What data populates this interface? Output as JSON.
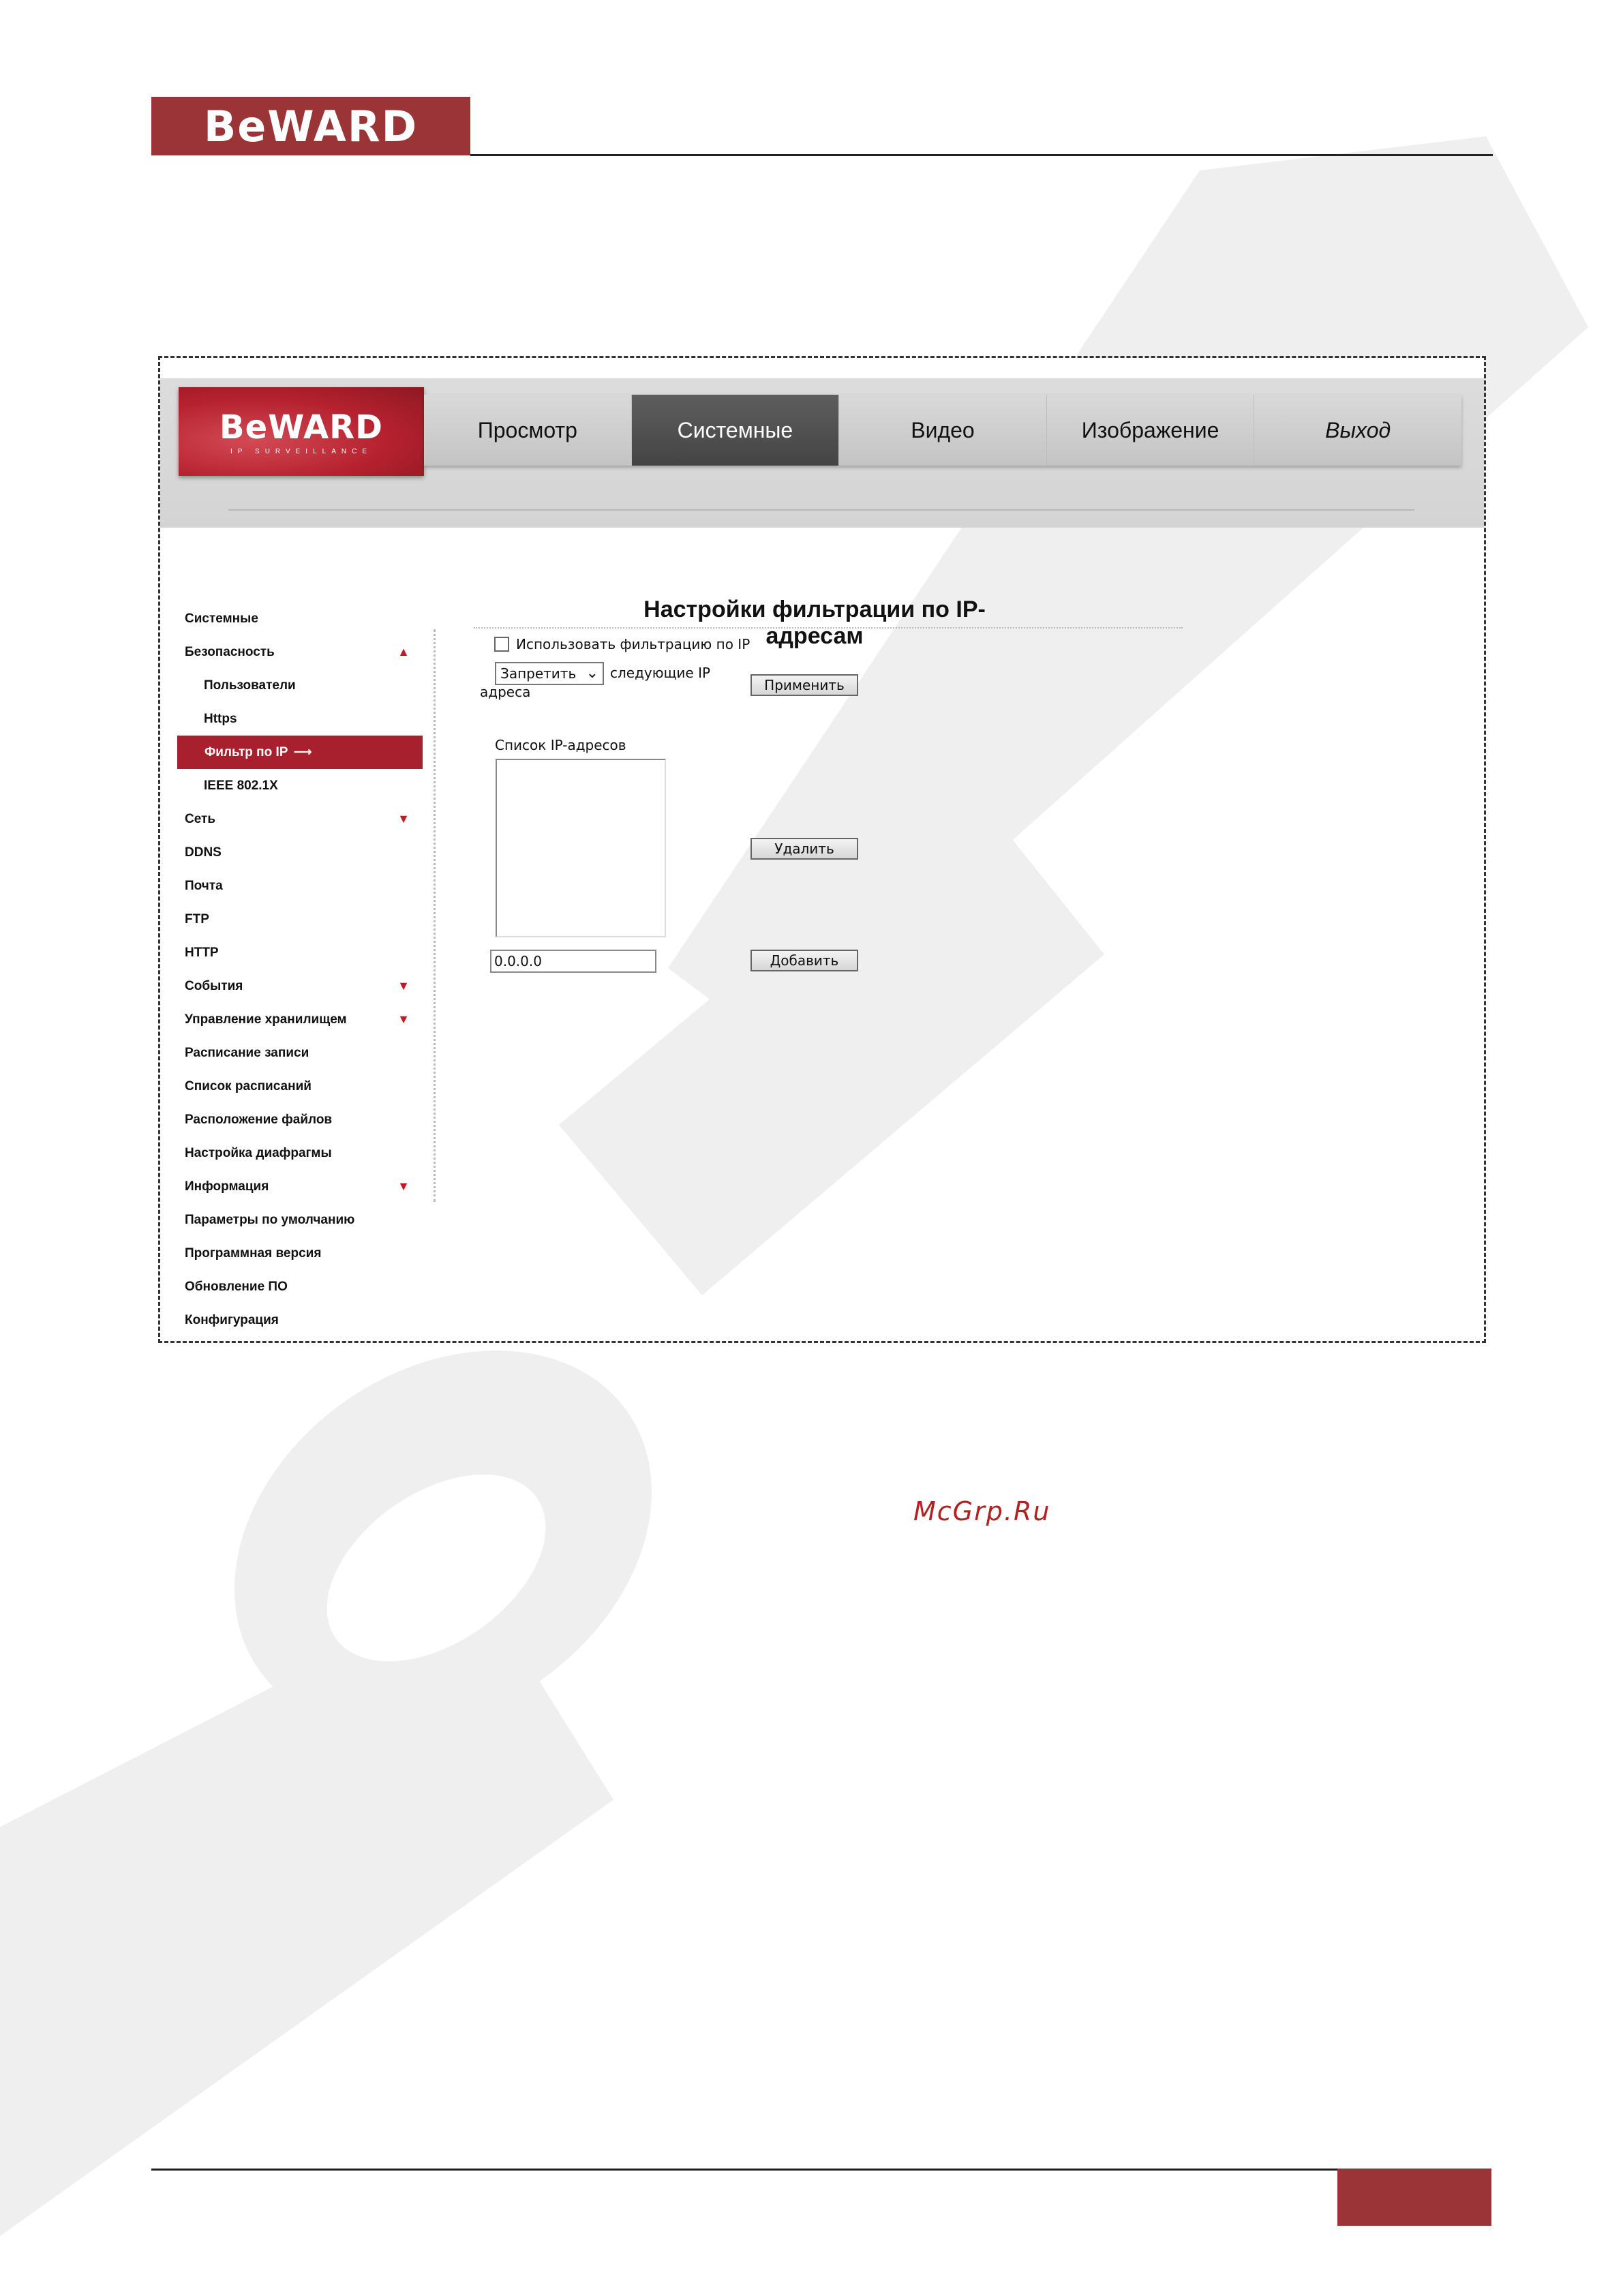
{
  "page": {
    "brand": "BeWARD",
    "watermark_text": "McGrp.Ru"
  },
  "ui": {
    "logo_brand": "BeWARD",
    "logo_tagline": "IP SURVEILLANCE",
    "nav_tabs": [
      {
        "label": "Просмотр",
        "active": false,
        "italic": false
      },
      {
        "label": "Системные",
        "active": true,
        "italic": false
      },
      {
        "label": "Видео",
        "active": false,
        "italic": false
      },
      {
        "label": "Изображение",
        "active": false,
        "italic": false
      },
      {
        "label": "Выход",
        "active": false,
        "italic": true
      }
    ],
    "sidebar": [
      {
        "label": "Системные",
        "level": 0,
        "icon": ""
      },
      {
        "label": "Безопасность",
        "level": 0,
        "icon": "triangle-up-icon"
      },
      {
        "label": "Пользователи",
        "level": 1,
        "icon": ""
      },
      {
        "label": "Https",
        "level": 1,
        "icon": ""
      },
      {
        "label": "Фильтр по IP",
        "level": 1,
        "icon": "arrow-right-icon",
        "active": true
      },
      {
        "label": "IEEE 802.1X",
        "level": 1,
        "icon": ""
      },
      {
        "label": "Сеть",
        "level": 0,
        "icon": "triangle-down-icon"
      },
      {
        "label": "DDNS",
        "level": 0,
        "icon": ""
      },
      {
        "label": "Почта",
        "level": 0,
        "icon": ""
      },
      {
        "label": "FTP",
        "level": 0,
        "icon": ""
      },
      {
        "label": "HTTP",
        "level": 0,
        "icon": ""
      },
      {
        "label": "События",
        "level": 0,
        "icon": "triangle-down-icon"
      },
      {
        "label": "Управление хранилищем",
        "level": 0,
        "icon": "triangle-down-icon"
      },
      {
        "label": "Расписание записи",
        "level": 0,
        "icon": ""
      },
      {
        "label": "Список расписаний",
        "level": 0,
        "icon": ""
      },
      {
        "label": "Расположение файлов",
        "level": 0,
        "icon": ""
      },
      {
        "label": "Настройка диафрагмы",
        "level": 0,
        "icon": ""
      },
      {
        "label": "Информация",
        "level": 0,
        "icon": "triangle-down-icon"
      },
      {
        "label": "Параметры по умолчанию",
        "level": 0,
        "icon": ""
      },
      {
        "label": "Программная версия",
        "level": 0,
        "icon": ""
      },
      {
        "label": "Обновление ПО",
        "level": 0,
        "icon": ""
      },
      {
        "label": "Конфигурация",
        "level": 0,
        "icon": ""
      }
    ],
    "content": {
      "title": "Настройки фильтрации по IP-адресам",
      "enable_checkbox_label": "Использовать фильтрацию по IP",
      "enable_checked": false,
      "mode_select_value": "Запретить",
      "following_text": "следующие IP",
      "address_text": "адреса",
      "apply_button": "Применить",
      "list_label": "Список IP-адресов",
      "ip_list_items": [],
      "delete_button": "Удалить",
      "ip_input_value": "0.0.0.0",
      "add_button": "Добавить"
    }
  },
  "colors": {
    "brand_red": "#9a3436",
    "ui_red": "#b6212f",
    "active_tab": "#505050",
    "sidebar_active": "#a8202d"
  }
}
